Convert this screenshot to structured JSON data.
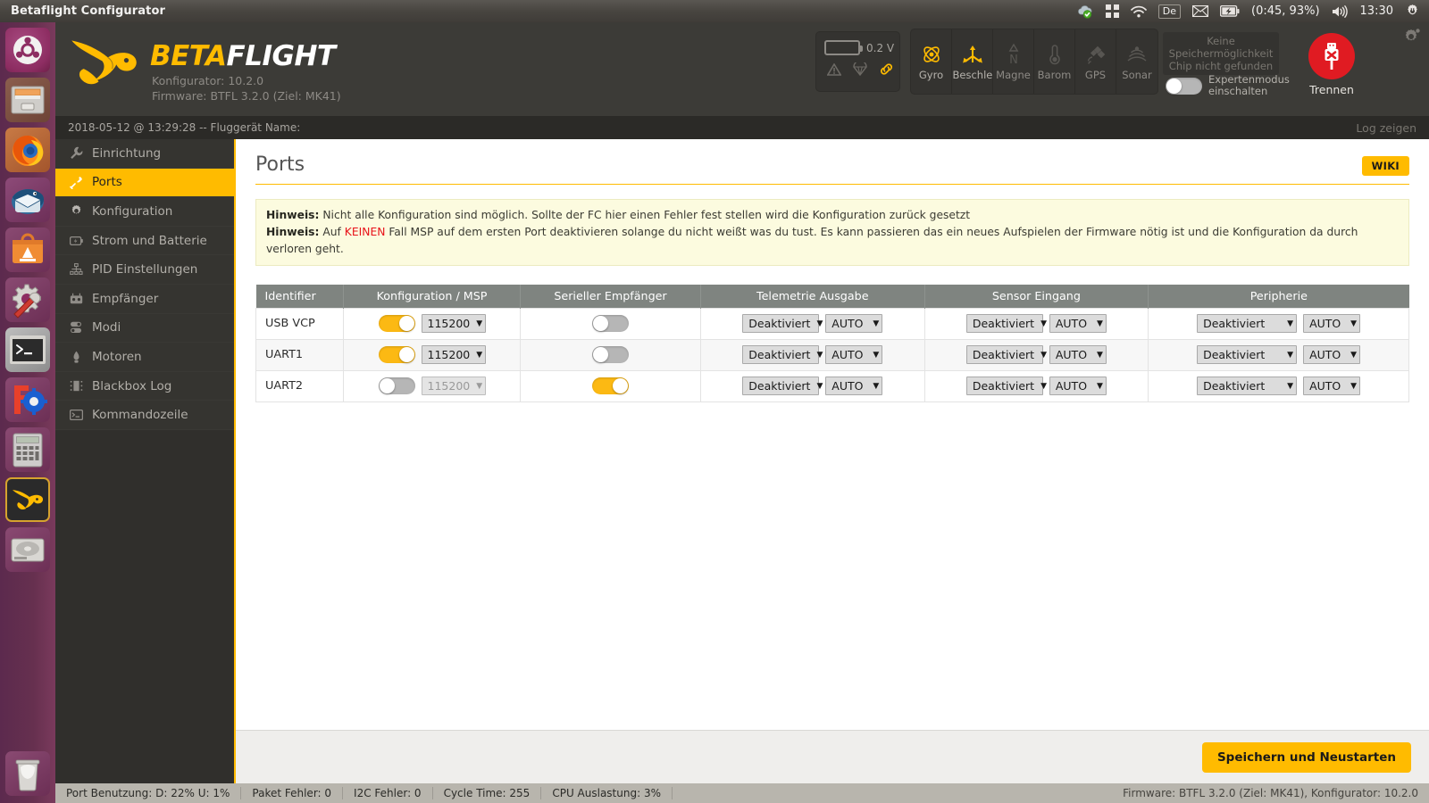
{
  "window": {
    "title": "Betaflight Configurator"
  },
  "top_panel": {
    "indicators": {
      "sync_icon": "cloud-check-icon",
      "workspaces_icon": "workspace-switcher-icon",
      "wifi_icon": "wifi-icon",
      "keyboard_layout": "De",
      "mail_icon": "envelope-icon",
      "battery_icon": "battery-charging-icon",
      "battery_text": "(0:45, 93%)",
      "volume_icon": "speaker-icon",
      "clock": "13:30",
      "session_icon": "gear-power-icon"
    }
  },
  "launcher": {
    "items": [
      {
        "name": "ubuntu-dash-icon",
        "label": "Ubuntu Dash",
        "running": false
      },
      {
        "name": "files-icon",
        "label": "Files",
        "running": true
      },
      {
        "name": "firefox-icon",
        "label": "Firefox",
        "running": true
      },
      {
        "name": "thunderbird-icon",
        "label": "Thunderbird",
        "running": false
      },
      {
        "name": "software-center-icon",
        "label": "Ubuntu Software",
        "running": false
      },
      {
        "name": "system-tools-icon",
        "label": "System Tools",
        "running": false
      },
      {
        "name": "terminal-icon",
        "label": "Terminal",
        "running": true
      },
      {
        "name": "freecad-icon",
        "label": "FreeCAD",
        "running": false
      },
      {
        "name": "calculator-icon",
        "label": "Calculator",
        "running": false
      },
      {
        "name": "betaflight-icon",
        "label": "Betaflight Configurator",
        "running": true,
        "focused": true
      },
      {
        "name": "disks-icon",
        "label": "Disks",
        "running": false
      },
      {
        "name": "trash-icon",
        "label": "Trash",
        "running": false
      }
    ]
  },
  "header": {
    "logo": {
      "part1": "BETA",
      "part2": "FLIGHT"
    },
    "configurator_version": "Konfigurator: 10.2.0",
    "firmware_version": "Firmware: BTFL 3.2.0 (Ziel: MK41)",
    "battery": {
      "voltage": "0.2 V",
      "icons": [
        "warning-icon",
        "parachute-icon",
        "link-icon"
      ]
    },
    "sensors": [
      {
        "label": "Gyro",
        "icon": "gyro-icon",
        "active": true
      },
      {
        "label": "Beschle",
        "icon": "accelerometer-icon",
        "active": true
      },
      {
        "label": "Magne",
        "icon": "magnetometer-icon",
        "active": false
      },
      {
        "label": "Barom",
        "icon": "barometer-icon",
        "active": false
      },
      {
        "label": "GPS",
        "icon": "gps-icon",
        "active": false
      },
      {
        "label": "Sonar",
        "icon": "sonar-icon",
        "active": false
      }
    ],
    "no_storage_line1": "Keine Speichermöglichkeit",
    "no_storage_line2": "Chip nicht gefunden",
    "expert_label_line1": "Expertenmodus",
    "expert_label_line2": "einschalten",
    "expert_enabled": false,
    "connect_label": "Trennen",
    "connect_icon": "usb-disconnect-icon",
    "settings_icon": "gear-icon",
    "accent_color": "#ffbb00",
    "disconnect_color": "#e01b22"
  },
  "statusline": {
    "text": "2018-05-12 @ 13:29:28 -- Fluggerät Name:",
    "log_link": "Log zeigen"
  },
  "sidebar": {
    "items": [
      {
        "label": "Einrichtung",
        "icon": "wrench-icon",
        "active": false
      },
      {
        "label": "Ports",
        "icon": "plug-icon",
        "active": true
      },
      {
        "label": "Konfiguration",
        "icon": "gear-icon",
        "active": false
      },
      {
        "label": "Strom und Batterie",
        "icon": "battery-icon",
        "active": false
      },
      {
        "label": "PID Einstellungen",
        "icon": "sliders-icon",
        "active": false
      },
      {
        "label": "Empfänger",
        "icon": "receiver-icon",
        "active": false
      },
      {
        "label": "Modi",
        "icon": "modes-icon",
        "active": false
      },
      {
        "label": "Motoren",
        "icon": "motor-icon",
        "active": false
      },
      {
        "label": "Blackbox Log",
        "icon": "blackbox-icon",
        "active": false
      },
      {
        "label": "Kommandozeile",
        "icon": "cli-icon",
        "active": false
      }
    ]
  },
  "main": {
    "page_title": "Ports",
    "wiki_label": "WIKI",
    "notice": {
      "line1_label": "Hinweis:",
      "line1_text": " Nicht alle Konfiguration sind möglich. Sollte der FC hier einen Fehler fest stellen wird die Konfiguration zurück gesetzt",
      "line2_label": "Hinweis:",
      "line2_pre": " Auf ",
      "line2_highlight": "KEINEN",
      "line2_post": " Fall MSP auf dem ersten Port deaktivieren solange du nicht weißt was du tust. Es kann passieren das ein neues Aufspielen der Firmware nötig ist und die Konfiguration da durch verloren geht."
    },
    "table": {
      "columns": [
        "Identifier",
        "Konfiguration / MSP",
        "Serieller Empfänger",
        "Telemetrie Ausgabe",
        "Sensor Eingang",
        "Peripherie"
      ],
      "rows": [
        {
          "identifier": "USB VCP",
          "msp_enabled": true,
          "baud": "115200",
          "baud_disabled": false,
          "serial_rx": false,
          "telemetry_function": "Deaktiviert",
          "telemetry_baud": "AUTO",
          "sensor_function": "Deaktiviert",
          "sensor_baud": "AUTO",
          "peripheral_function": "Deaktiviert",
          "peripheral_baud": "AUTO"
        },
        {
          "identifier": "UART1",
          "msp_enabled": true,
          "baud": "115200",
          "baud_disabled": false,
          "serial_rx": false,
          "telemetry_function": "Deaktiviert",
          "telemetry_baud": "AUTO",
          "sensor_function": "Deaktiviert",
          "sensor_baud": "AUTO",
          "peripheral_function": "Deaktiviert",
          "peripheral_baud": "AUTO"
        },
        {
          "identifier": "UART2",
          "msp_enabled": false,
          "baud": "115200",
          "baud_disabled": true,
          "serial_rx": true,
          "telemetry_function": "Deaktiviert",
          "telemetry_baud": "AUTO",
          "sensor_function": "Deaktiviert",
          "sensor_baud": "AUTO",
          "peripheral_function": "Deaktiviert",
          "peripheral_baud": "AUTO"
        }
      ]
    },
    "save_label": "Speichern und Neustarten"
  },
  "bottom_status": {
    "cells": [
      "Port Benutzung: D: 22% U: 1%",
      "Paket Fehler: 0",
      "I2C Fehler: 0",
      "Cycle Time: 255",
      "CPU Auslastung: 3%"
    ],
    "right": "Firmware: BTFL 3.2.0 (Ziel: MK41), Konfigurator: 10.2.0"
  }
}
